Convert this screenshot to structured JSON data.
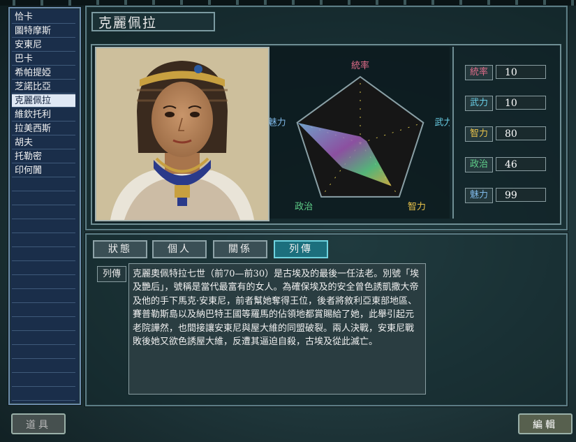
{
  "character_list": {
    "items": [
      "恰卡",
      "圖特摩斯",
      "安東尼",
      "巴卡",
      "希帕提婭",
      "芝諾比亞",
      "克麗佩拉",
      "維欽托利",
      "拉美西斯",
      "胡夫",
      "托勒密",
      "印何闐"
    ],
    "selected_index": 6,
    "empty_rows": 16
  },
  "character": {
    "name": "克麗佩拉"
  },
  "radar": {
    "axes": [
      "統率",
      "武力",
      "智力",
      "政治",
      "魅力"
    ],
    "axis_colors": [
      "#e06d8a",
      "#6ad0e8",
      "#e8c24a",
      "#5fd08a",
      "#7fb8e8"
    ],
    "max": 100
  },
  "stats": [
    {
      "label": "統率",
      "value": "10",
      "color": "#e06d8a"
    },
    {
      "label": "武力",
      "value": "10",
      "color": "#6ad0e8"
    },
    {
      "label": "智力",
      "value": "80",
      "color": "#e8c24a"
    },
    {
      "label": "政治",
      "value": "46",
      "color": "#5fd08a"
    },
    {
      "label": "魅力",
      "value": "99",
      "color": "#7fb8e8"
    }
  ],
  "tabs": [
    "狀態",
    "個人",
    "關係",
    "列傳"
  ],
  "active_tab": 3,
  "bio": {
    "label": "列傳",
    "text": "克麗奧佩特拉七世（前70—前30）是古埃及的最後一任法老。別號「埃及艷后」，號稱是當代最富有的女人。為確保埃及的安全曾色誘凱撒大帝及他的手下馬克·安東尼，前者幫她奪得王位，後者將敘利亞東部地區、賽普勒斯島以及納巴特王國等羅馬的佔領地都賞賜給了她，此舉引起元老院譁然，也間接讓安東尼與屋大維的同盟破裂。兩人決戰，安東尼戰敗後她又欲色誘屋大維，反遭其逼迫自殺，古埃及從此滅亡。"
  },
  "buttons": {
    "items": "道具",
    "edit": "編輯"
  }
}
